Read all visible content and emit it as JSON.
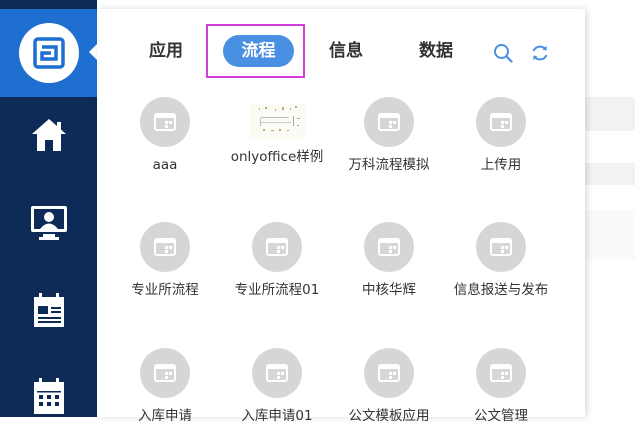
{
  "tabs": [
    {
      "label": "应用"
    },
    {
      "label": "流程"
    },
    {
      "label": "信息"
    },
    {
      "label": "数据"
    }
  ],
  "active_tab": "流程",
  "icons": {
    "logo": "app-logo-icon",
    "search": "search-icon",
    "refresh": "refresh-icon"
  },
  "sidebar": {
    "items": [
      {
        "icon": "home-icon"
      },
      {
        "icon": "monitor-user-icon"
      },
      {
        "icon": "calendar-note-icon"
      },
      {
        "icon": "calendar-icon"
      }
    ]
  },
  "apps": [
    {
      "label": "aaa",
      "thumbnail": false
    },
    {
      "label": "onlyoffice样例",
      "thumbnail": true
    },
    {
      "label": "万科流程模拟",
      "thumbnail": false
    },
    {
      "label": "上传用",
      "thumbnail": false
    },
    {
      "label": "专业所流程",
      "thumbnail": false
    },
    {
      "label": "专业所流程01",
      "thumbnail": false
    },
    {
      "label": "中核华辉",
      "thumbnail": false
    },
    {
      "label": "信息报送与发布",
      "thumbnail": false
    },
    {
      "label": "入库申请",
      "thumbnail": false
    },
    {
      "label": "入库申请01",
      "thumbnail": false
    },
    {
      "label": "公文模板应用",
      "thumbnail": false
    },
    {
      "label": "公文管理",
      "thumbnail": false
    }
  ],
  "colors": {
    "sidebar": "#0e2a57",
    "sidebar_top": "#1f6fd0",
    "accent": "#4a90e2",
    "highlight_box": "#d13fd8",
    "app_icon_bg": "#d6d6d6"
  }
}
